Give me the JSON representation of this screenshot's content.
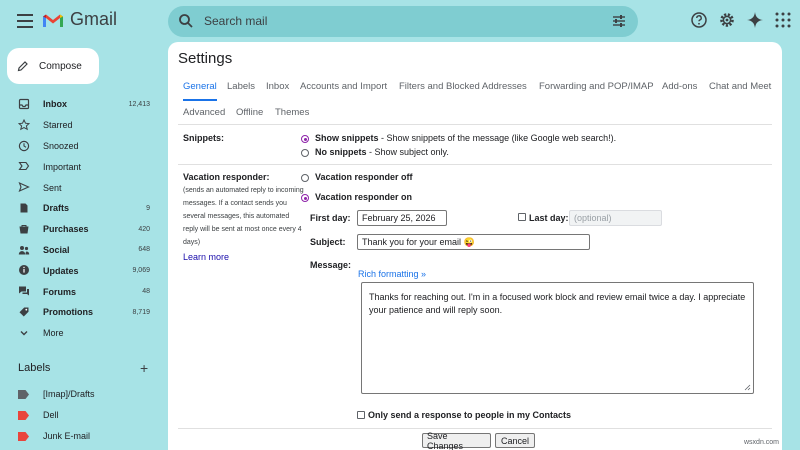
{
  "app": {
    "name": "Gmail"
  },
  "search": {
    "placeholder": "Search mail"
  },
  "header_icons": [
    "help-icon",
    "settings-gear-icon",
    "gemini-sparkle-icon",
    "apps-grid-icon"
  ],
  "compose": {
    "label": "Compose"
  },
  "nav": [
    {
      "label": "Inbox",
      "count": "12,413",
      "bold": true,
      "icon": "inbox-icon"
    },
    {
      "label": "Starred",
      "count": "",
      "bold": false,
      "icon": "star-icon"
    },
    {
      "label": "Snoozed",
      "count": "",
      "bold": false,
      "icon": "clock-icon"
    },
    {
      "label": "Important",
      "count": "",
      "bold": false,
      "icon": "important-icon"
    },
    {
      "label": "Sent",
      "count": "",
      "bold": false,
      "icon": "send-icon"
    },
    {
      "label": "Drafts",
      "count": "9",
      "bold": true,
      "icon": "draft-icon"
    },
    {
      "label": "Purchases",
      "count": "420",
      "bold": true,
      "icon": "purchases-icon"
    },
    {
      "label": "Social",
      "count": "648",
      "bold": true,
      "icon": "social-icon"
    },
    {
      "label": "Updates",
      "count": "9,069",
      "bold": true,
      "icon": "updates-icon"
    },
    {
      "label": "Forums",
      "count": "48",
      "bold": true,
      "icon": "forums-icon"
    },
    {
      "label": "Promotions",
      "count": "8,719",
      "bold": true,
      "icon": "promotions-icon"
    },
    {
      "label": "More",
      "count": "",
      "bold": false,
      "icon": "chevron-down-icon"
    }
  ],
  "labels": {
    "heading": "Labels",
    "items": [
      {
        "name": "[Imap]/Drafts",
        "color": "#5f6368"
      },
      {
        "name": "Dell",
        "color": "#e8453c"
      },
      {
        "name": "Junk E-mail",
        "color": "#e8453c"
      }
    ]
  },
  "settings": {
    "title": "Settings",
    "tabs_row1": [
      "General",
      "Labels",
      "Inbox",
      "Accounts and Import",
      "Filters and Blocked Addresses",
      "Forwarding and POP/IMAP",
      "Add-ons",
      "Chat and Meet"
    ],
    "tabs_row2": [
      "Advanced",
      "Offline",
      "Themes"
    ],
    "active_tab": "General",
    "snippets": {
      "label": "Snippets:",
      "opt1_bold": "Show snippets",
      "opt1_rest": " - Show snippets of the message (like Google web search!).",
      "opt2_bold": "No snippets",
      "opt2_rest": " - Show subject only."
    },
    "vacation": {
      "label": "Vacation responder:",
      "help": "(sends an automated reply to incoming messages. If a contact sends you several messages, this automated reply will be sent at most once every 4 days)",
      "learn_more": "Learn more",
      "off_label": "Vacation responder off",
      "on_label": "Vacation responder on",
      "first_day_label": "First day:",
      "first_day_value": "February 25, 2026",
      "last_day_label": "Last day:",
      "last_day_placeholder": "(optional)",
      "subject_label": "Subject:",
      "subject_value": "Thank you for your email 😜",
      "message_label": "Message:",
      "rich_formatting": "Rich formatting »",
      "message_body": "Thanks for reaching out. I'm in a focused work block and review email twice a day. I appreciate your patience and will reply soon.",
      "contacts_only": "Only send a response to people in my Contacts"
    },
    "buttons": {
      "save": "Save Changes",
      "cancel": "Cancel"
    }
  },
  "watermark": "wsxdn.com",
  "colors": {
    "background": "#a7e3e6",
    "search_bg": "#7fcdd1",
    "accent": "#1a73e8",
    "radio_selected": "#8e24aa"
  }
}
